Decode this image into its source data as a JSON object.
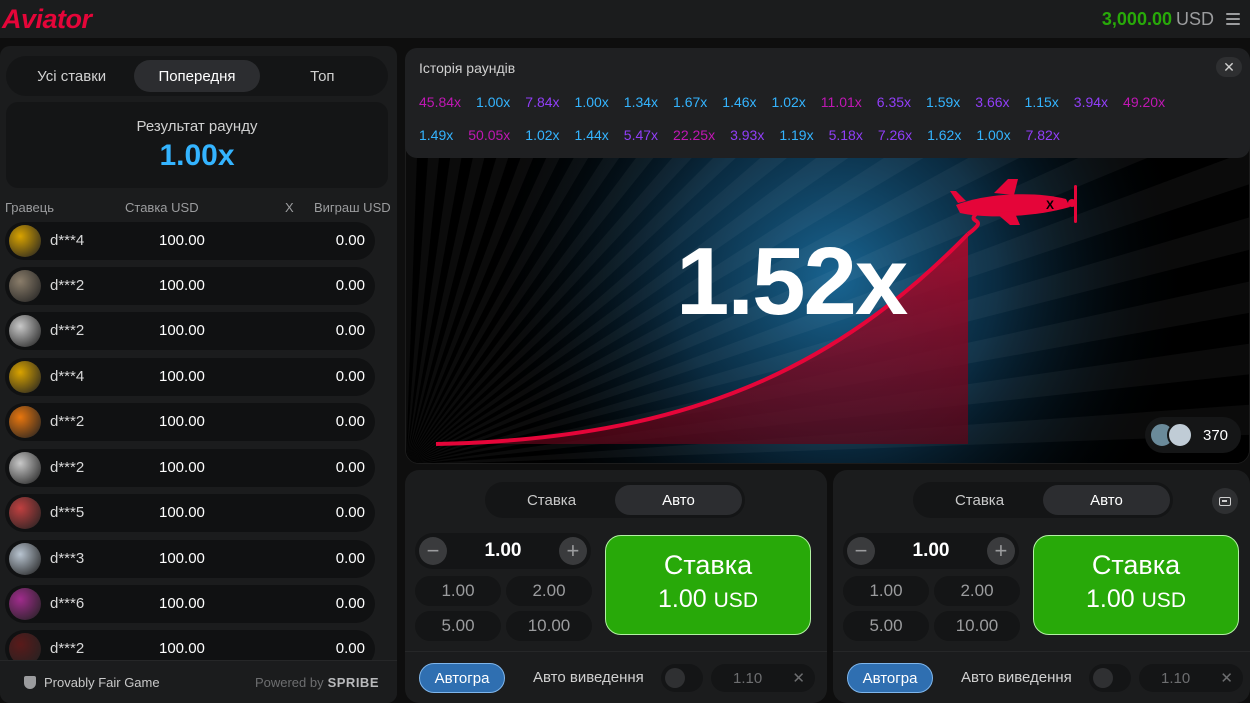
{
  "header": {
    "logo": "Aviator",
    "balance_amount": "3,000.00",
    "balance_currency": "USD"
  },
  "left_panel": {
    "tabs": [
      {
        "label": "Усі ставки"
      },
      {
        "label": "Попередня"
      },
      {
        "label": "Топ"
      }
    ],
    "round_result_label": "Результат раунду",
    "round_result_value": "1.00x",
    "columns": {
      "player": "Гравець",
      "bet": "Ставка USD",
      "x": "X",
      "win": "Виграш USD"
    },
    "rows": [
      {
        "name": "d***4",
        "bet": "100.00",
        "win": "0.00",
        "avatar": "#d9a300"
      },
      {
        "name": "d***2",
        "bet": "100.00",
        "win": "0.00",
        "avatar": "#8a7d6a"
      },
      {
        "name": "d***2",
        "bet": "100.00",
        "win": "0.00",
        "avatar": "#c8c8c8"
      },
      {
        "name": "d***4",
        "bet": "100.00",
        "win": "0.00",
        "avatar": "#d9a300"
      },
      {
        "name": "d***2",
        "bet": "100.00",
        "win": "0.00",
        "avatar": "#e8760e"
      },
      {
        "name": "d***2",
        "bet": "100.00",
        "win": "0.00",
        "avatar": "#c8c8c8"
      },
      {
        "name": "d***5",
        "bet": "100.00",
        "win": "0.00",
        "avatar": "#c04040"
      },
      {
        "name": "d***3",
        "bet": "100.00",
        "win": "0.00",
        "avatar": "#b8c4d0"
      },
      {
        "name": "d***6",
        "bet": "100.00",
        "win": "0.00",
        "avatar": "#a02c8c"
      },
      {
        "name": "d***2",
        "bet": "100.00",
        "win": "0.00",
        "avatar": "#5a1a1a"
      }
    ],
    "footer": {
      "fair": "Provably Fair Game",
      "powered": "Powered by",
      "brand": "SPRIBE"
    }
  },
  "history": {
    "title": "Історія раундів",
    "close": "✕",
    "row1": [
      {
        "v": "45.84x",
        "c": "#c017b4"
      },
      {
        "v": "1.00x",
        "c": "#34b4ff"
      },
      {
        "v": "7.84x",
        "c": "#913ef8"
      },
      {
        "v": "1.00x",
        "c": "#34b4ff"
      },
      {
        "v": "1.34x",
        "c": "#34b4ff"
      },
      {
        "v": "1.67x",
        "c": "#34b4ff"
      },
      {
        "v": "1.46x",
        "c": "#34b4ff"
      },
      {
        "v": "1.02x",
        "c": "#34b4ff"
      },
      {
        "v": "11.01x",
        "c": "#c017b4"
      },
      {
        "v": "6.35x",
        "c": "#913ef8"
      },
      {
        "v": "1.59x",
        "c": "#34b4ff"
      },
      {
        "v": "3.66x",
        "c": "#913ef8"
      },
      {
        "v": "1.15x",
        "c": "#34b4ff"
      },
      {
        "v": "3.94x",
        "c": "#913ef8"
      },
      {
        "v": "49.20x",
        "c": "#c017b4"
      }
    ],
    "row2": [
      {
        "v": "1.49x",
        "c": "#34b4ff"
      },
      {
        "v": "50.05x",
        "c": "#c017b4"
      },
      {
        "v": "1.02x",
        "c": "#34b4ff"
      },
      {
        "v": "1.44x",
        "c": "#34b4ff"
      },
      {
        "v": "5.47x",
        "c": "#913ef8"
      },
      {
        "v": "22.25x",
        "c": "#c017b4"
      },
      {
        "v": "3.93x",
        "c": "#913ef8"
      },
      {
        "v": "1.19x",
        "c": "#34b4ff"
      },
      {
        "v": "5.18x",
        "c": "#913ef8"
      },
      {
        "v": "7.26x",
        "c": "#913ef8"
      },
      {
        "v": "1.62x",
        "c": "#34b4ff"
      },
      {
        "v": "1.00x",
        "c": "#34b4ff"
      },
      {
        "v": "7.82x",
        "c": "#913ef8"
      }
    ]
  },
  "game": {
    "multiplier": "1.52x",
    "online_count": "370",
    "plane_mark": "X"
  },
  "bet_panels": [
    {
      "tabs": [
        {
          "label": "Ставка"
        },
        {
          "label": "Авто"
        }
      ],
      "amount": "1.00",
      "minus": "−",
      "plus": "+",
      "quick": [
        "1.00",
        "2.00",
        "5.00",
        "10.00"
      ],
      "button_line1": "Ставка",
      "button_amount": "1.00",
      "button_currency": "USD",
      "auto_play": "Автогра",
      "auto_cashout": "Авто виведення",
      "cashout_value": "1.10",
      "clear": "✕"
    },
    {
      "tabs": [
        {
          "label": "Ставка"
        },
        {
          "label": "Авто"
        }
      ],
      "amount": "1.00",
      "minus": "−",
      "plus": "+",
      "quick": [
        "1.00",
        "2.00",
        "5.00",
        "10.00"
      ],
      "button_line1": "Ставка",
      "button_amount": "1.00",
      "button_currency": "USD",
      "auto_play": "Автогра",
      "auto_cashout": "Авто виведення",
      "cashout_value": "1.10",
      "clear": "✕"
    }
  ],
  "colors": {
    "accent_red": "#e50539",
    "green": "#28a909",
    "blue": "#34b4ff",
    "purple": "#913ef8",
    "pink": "#c017b4"
  }
}
